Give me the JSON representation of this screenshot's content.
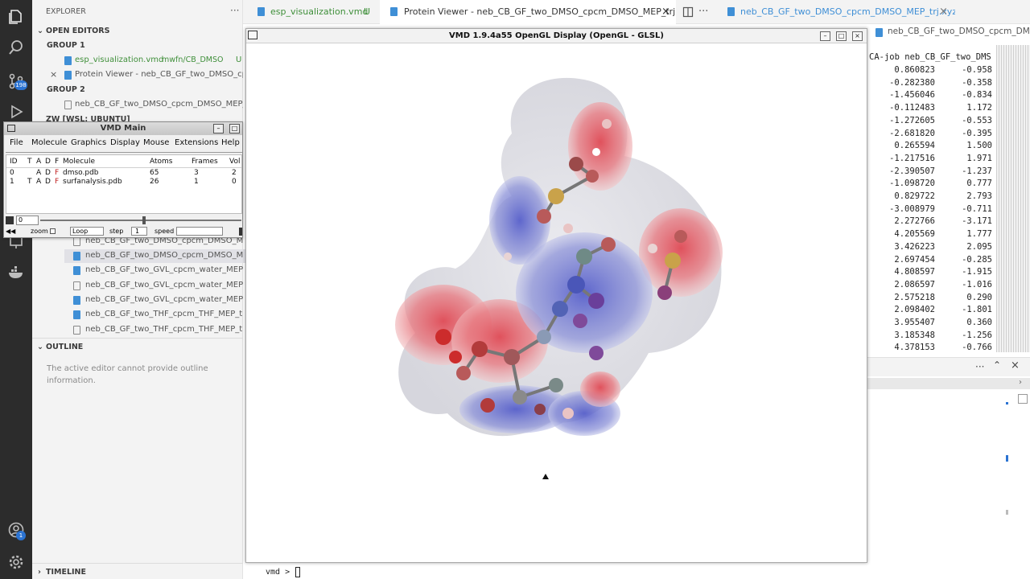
{
  "activity_bar": {
    "scm_badge": "198",
    "account_badge": "1"
  },
  "sidebar": {
    "title": "EXPLORER",
    "open_editors_label": "OPEN EDITORS",
    "group1_label": "GROUP 1",
    "group1_files": [
      {
        "name": "esp_visualization.vmd",
        "path": "mwfn/CB_DMSO",
        "status": "U"
      },
      {
        "name": "Protein Viewer - neb_CB_GF_two_DMSO_cpcm_DMSO_MEP_trj.xyz"
      }
    ],
    "group2_label": "GROUP 2",
    "group2_files": [
      {
        "name": "neb_CB_GF_two_DMSO_cpcm_DMSO_MEP_trj.xyz"
      }
    ],
    "workspace_label": "ZW [WSL: UBUNTU]",
    "tree_files": [
      "neb_CB_GF_two_DMSO_cpcm_DMSO_MEP_trj.xyz",
      "neb_CB_GF_two_DMSO_cpcm_DMSO_MEP_trj.xyz",
      "neb_CB_GF_two_GVL_cpcm_water_MEP_trj.xyz",
      "neb_CB_GF_two_GVL_cpcm_water_MEP_trj.xyz",
      "neb_CB_GF_two_GVL_cpcm_water_MEP_trj.xyz",
      "neb_CB_GF_two_THF_cpcm_THF_MEP_trj.xyz",
      "neb_CB_GF_two_THF_cpcm_THF_MEP_trj.xyz"
    ],
    "outline_label": "OUTLINE",
    "outline_message": "The active editor cannot provide outline information.",
    "timeline_label": "TIMELINE"
  },
  "tabs": [
    {
      "label": "esp_visualization.vmd",
      "status": "U"
    },
    {
      "label": "Protein Viewer - neb_CB_GF_two_DMSO_cpcm_DMSO_MEP_trj.xyz"
    },
    {
      "label": "neb_CB_GF_two_DMSO_cpcm_DMSO_MEP_trj.xyz"
    }
  ],
  "breadcrumb": "neb_CB_GF_two_DMSO_cpcm_DMSO_MEP_trj.xyz",
  "vmd_display": {
    "title": "VMD 1.9.4a55 OpenGL Display (OpenGL - GLSL)"
  },
  "vmd_main": {
    "title": "VMD Main",
    "menu": [
      "File",
      "Molecule",
      "Graphics",
      "Display",
      "Mouse",
      "Extensions",
      "Help"
    ],
    "columns": [
      "ID",
      "T",
      "A",
      "D",
      "F",
      "Molecule",
      "Atoms",
      "Frames",
      "Vol"
    ],
    "rows": [
      {
        "id": "0",
        "t": "",
        "a": "A",
        "d": "D",
        "f": "F",
        "molecule": "dmso.pdb",
        "atoms": "65",
        "frames": "3",
        "vol": "2"
      },
      {
        "id": "1",
        "t": "T",
        "a": "A",
        "d": "D",
        "f": "F",
        "molecule": "surfanalysis.pdb",
        "atoms": "26",
        "frames": "1",
        "vol": "0"
      }
    ],
    "frame_value": "0",
    "zoom_label": "zoom",
    "loop_value": "Loop",
    "step_label": "step",
    "step_value": "1",
    "speed_label": "speed"
  },
  "data_panel": {
    "header": "CA-job neb_CB_GF_two_DMS",
    "col1": [
      "0.860823",
      "-0.282380",
      "-1.456046",
      "-0.112483",
      "-1.272605",
      "-2.681820",
      "0.265594",
      "-1.217516",
      "-2.390507",
      "-1.098720",
      "0.829722",
      "-3.008979",
      "2.272766",
      "4.205569",
      "3.426223",
      "2.697454",
      "4.808597",
      "2.086597",
      "2.575218",
      "2.098402",
      "3.955407",
      "3.185348",
      "4.378153"
    ],
    "col2": [
      "-0.958",
      "-0.358",
      "-0.834",
      "1.172",
      "-0.553",
      "-0.395",
      "1.500",
      "1.971",
      "-1.237",
      "0.777",
      "2.793",
      "-0.711",
      "-3.171",
      "1.777",
      "2.095",
      "-0.285",
      "-1.915",
      "-1.016",
      "0.290",
      "-1.801",
      "0.360",
      "-1.256",
      "-0.766"
    ]
  },
  "terminal": {
    "prompt": "vmd >"
  },
  "colors": {
    "tab_green": "#3f8f3a",
    "file_blue": "#3f8fd6",
    "activity": "#2c2c2c"
  }
}
